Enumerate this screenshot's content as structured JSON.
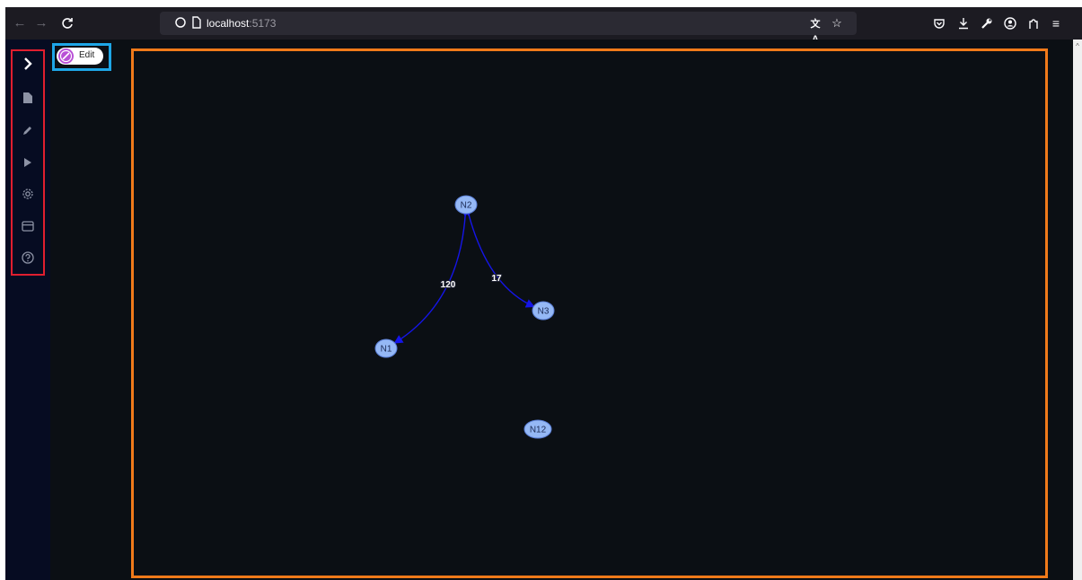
{
  "browser": {
    "url_host": "localhost",
    "url_port": ":5173"
  },
  "sidebar": {
    "items": [
      {
        "icon": "chevron-right-icon"
      },
      {
        "icon": "file-icon"
      },
      {
        "icon": "pencil-icon"
      },
      {
        "icon": "play-icon"
      },
      {
        "icon": "gear-icon"
      },
      {
        "icon": "window-icon"
      },
      {
        "icon": "help-icon"
      }
    ]
  },
  "edit_toggle": {
    "label": "Edit"
  },
  "graph": {
    "nodes": [
      {
        "id": "N2"
      },
      {
        "id": "N3"
      },
      {
        "id": "N1"
      },
      {
        "id": "N12"
      }
    ],
    "edges": [
      {
        "from": "N2",
        "to": "N1",
        "label": "120"
      },
      {
        "from": "N2",
        "to": "N3",
        "label": "17"
      }
    ],
    "colors": {
      "node_fill": "#95b8f5",
      "node_stroke": "#5b7fd6",
      "edge": "#1515e8"
    }
  }
}
